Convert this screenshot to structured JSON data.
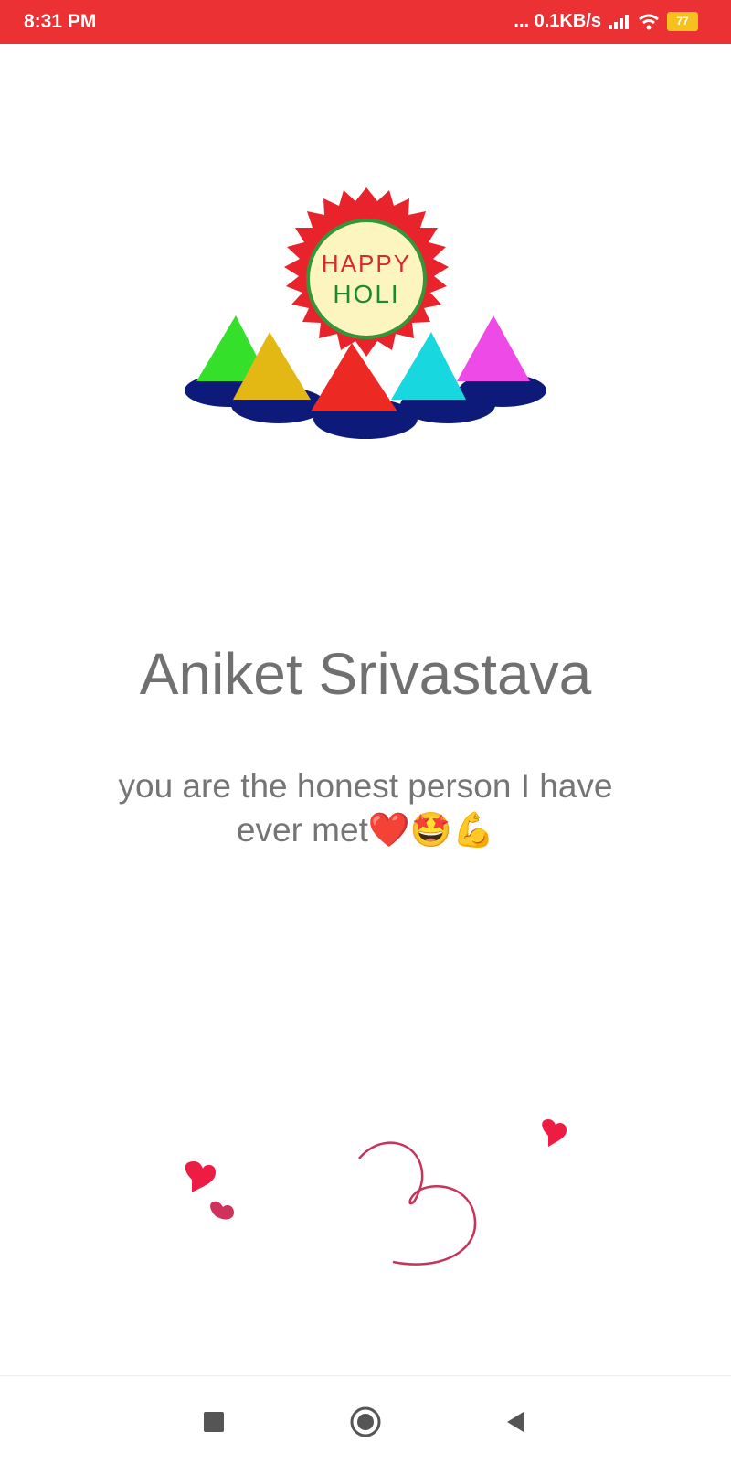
{
  "status_bar": {
    "time": "8:31 PM",
    "network_speed": "... 0.1KB/s",
    "battery": "77",
    "background": "#ec3134"
  },
  "logo": {
    "line1": "HAPPY",
    "line2": "HOLI"
  },
  "main": {
    "name": "Aniket Srivastava",
    "message": "you are the honest person I have ever met❤️🤩💪"
  },
  "nav": {
    "icons": [
      "recents-square-icon",
      "home-circle-icon",
      "back-triangle-icon"
    ]
  }
}
